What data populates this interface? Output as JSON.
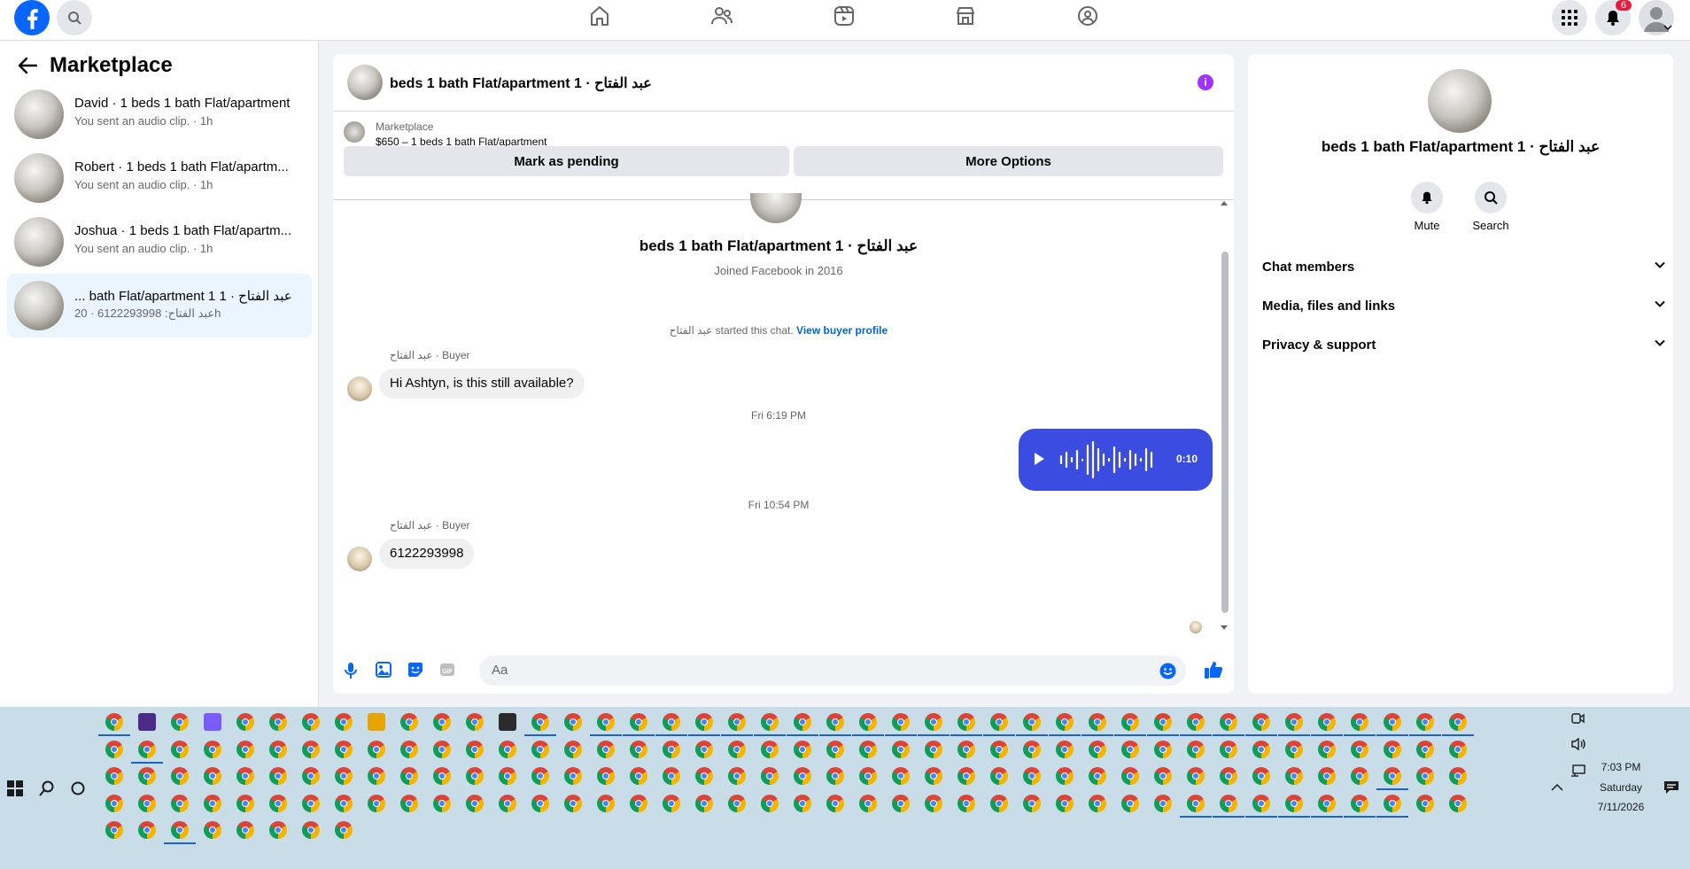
{
  "colors": {
    "brand": "#0866ff",
    "audio_bubble": "#3b4de0",
    "notification": "#e41e3f",
    "link": "#0064d1"
  },
  "topbar": {
    "nav_icons": [
      "home-icon",
      "friends-icon",
      "video-icon",
      "marketplace-icon",
      "groups-icon"
    ],
    "notification_count": "6"
  },
  "sidebar": {
    "title": "Marketplace",
    "conversations": [
      {
        "name": "David · 1 beds 1 bath Flat/apartment",
        "preview": "You sent an audio clip. · 1h"
      },
      {
        "name": "Robert · 1 beds 1 bath Flat/apartm...",
        "preview": "You sent an audio clip. · 1h"
      },
      {
        "name": "Joshua · 1 beds 1 bath Flat/apartm...",
        "preview": "You sent an audio clip. · 1h"
      },
      {
        "name": "عبد الفتاح · 1 bath Flat/apartment 1 ...",
        "preview": "عبد الفتاح: 6122293998 · 20h"
      }
    ]
  },
  "chat": {
    "title": "عبد الفتاح · 1 beds 1 bath Flat/apartment",
    "listing_source": "Marketplace",
    "listing": "$650 – 1 beds 1 bath Flat/apartment",
    "mark_pending_label": "Mark as pending",
    "more_options_label": "More Options",
    "profile_name": "عبد الفتاح · 1 beds 1 bath Flat/apartment",
    "joined": "Joined Facebook in 2016",
    "started_text": "عبد الفتاح started this chat.",
    "view_buyer_profile": "View buyer profile",
    "sender_label": "عبد الفتاح · Buyer",
    "message_1": "Hi Ashtyn, is this still available?",
    "timestamp_1": "Fri 6:19 PM",
    "audio_duration": "0:10",
    "timestamp_2": "Fri 10:54 PM",
    "message_2": "6122293998",
    "composer_placeholder": "Aa"
  },
  "info_panel": {
    "name": "عبد الفتاح · 1 beds 1 bath Flat/apartment",
    "mute_label": "Mute",
    "search_label": "Search",
    "sections": [
      "Chat members",
      "Media, files and links",
      "Privacy & support"
    ]
  },
  "taskbar": {
    "time": "7:03 PM",
    "day": "Saturday",
    "date": "7/11/2026"
  }
}
